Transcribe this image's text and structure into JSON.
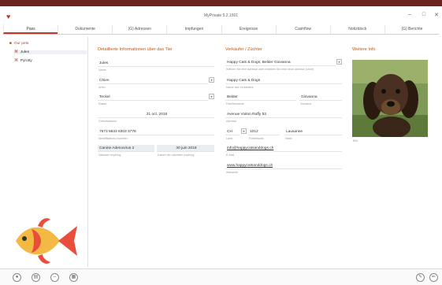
{
  "window": {
    "title": "MyPrivate 5.2.1501",
    "minimize": "–",
    "maximize": "□",
    "close": "✕"
  },
  "tabs": [
    "Pass",
    "Dokumente",
    "(G) Adressen",
    "Impfungen",
    "Ereignisse",
    "Cashflow",
    "Notizblock",
    "(G) Berichte"
  ],
  "sidebar": {
    "root": "Our pets",
    "items": [
      "Jules",
      "Pyrotty"
    ]
  },
  "details": {
    "section_title": "Detaillierte Informationen über das Tier",
    "name": {
      "value": "Jules",
      "label": "Name"
    },
    "art": {
      "value": "Chien",
      "label": "Arten"
    },
    "rasse": {
      "value": "Teckel",
      "label": "Rasse"
    },
    "geburt": {
      "value": "31 oct. 2018",
      "label": "Geburtsdatum"
    },
    "id": {
      "value": "7573 6833 8303 3778",
      "label": "Identifikations-Nummer"
    },
    "empfang": {
      "value": "Canine Adenovirus 2",
      "label": "Nächster Impfung"
    },
    "datum": {
      "value": "30 juin 2018",
      "label": "Datum der nächsten Impfung"
    }
  },
  "seller": {
    "section_title": "Verkäufer / Züchter",
    "company": {
      "value": "Happy Cats & Dogs; Belder Giovanna",
      "label": "Wählen Sie eine Adresse oder erstellen Sie eine neue Adresse (ohne)"
    },
    "shop": {
      "value": "Happy Cats & Dogs",
      "label": "Name des Verkäufers"
    },
    "lastname": {
      "value": "Belder",
      "label": "Familienname"
    },
    "firstname": {
      "value": "Giovanna",
      "label": "Vorname"
    },
    "address": {
      "value": "Avenue Voiton Raffy 53",
      "label": "Adresse"
    },
    "country": {
      "value": "CH",
      "label": "Land"
    },
    "zip": {
      "value": "1012",
      "label": "Postleitzahl"
    },
    "city": {
      "value": "Lausanne",
      "label": "Stadt"
    },
    "email": {
      "value": "info@happycatsanddogs.ch",
      "label": "E-Mail"
    },
    "web": {
      "value": "www.happycatsanddogs.ch",
      "label": "Webseite"
    }
  },
  "info": {
    "section_title": "Weitere Info",
    "photo_label": "Bild"
  },
  "icons": {
    "app": "app-icon",
    "folder": "folder-icon",
    "pet": "pet-icon",
    "fish": "fish-logo"
  },
  "colors": {
    "accent": "#c0392b",
    "section": "#d35400",
    "topbar": "#6b2322"
  },
  "bottom": {
    "left_buttons": [
      "●",
      "▤",
      "⇔",
      "▦"
    ],
    "right_buttons": [
      "✎",
      "⇐"
    ]
  }
}
